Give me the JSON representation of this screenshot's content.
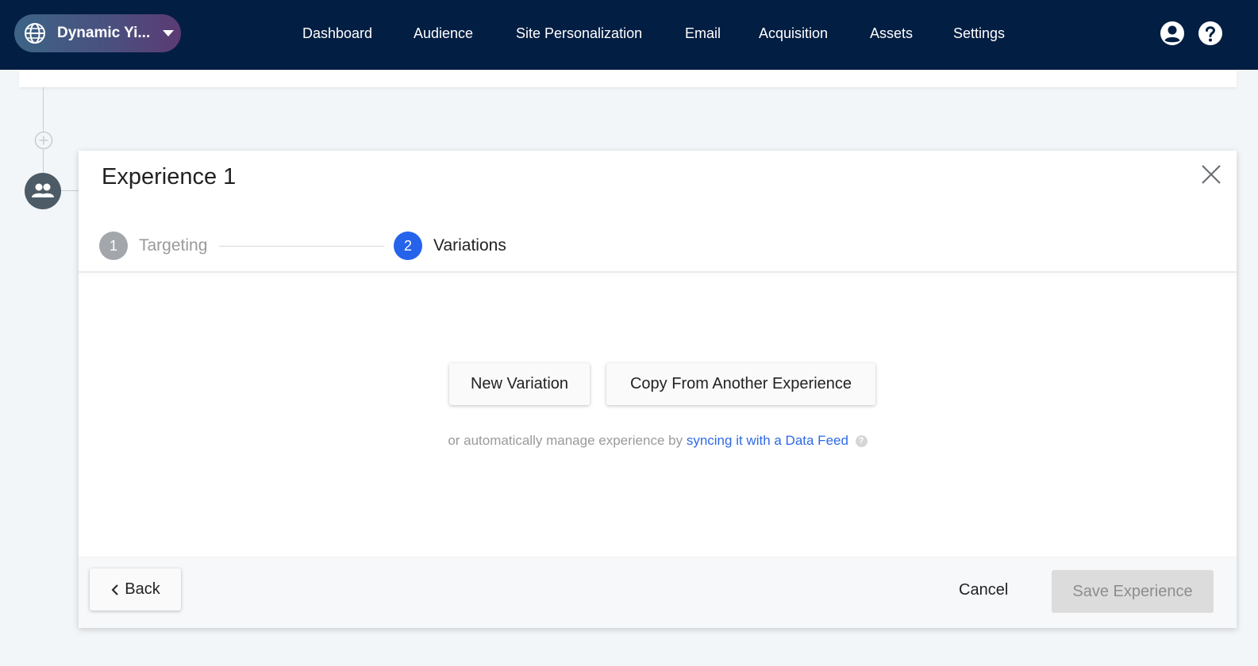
{
  "topbar": {
    "site_selector": {
      "label": "Dynamic Yi...",
      "icon": "globe-icon",
      "caret": "chevron-down-icon"
    },
    "nav_items": [
      {
        "label": "Dashboard"
      },
      {
        "label": "Audience"
      },
      {
        "label": "Site Personalization"
      },
      {
        "label": "Email"
      },
      {
        "label": "Acquisition"
      },
      {
        "label": "Assets"
      },
      {
        "label": "Settings"
      }
    ],
    "icons": [
      "user-account-icon",
      "help-icon"
    ]
  },
  "flow": {
    "add_icon": "plus-circle-icon",
    "audience_icon": "users-icon"
  },
  "modal": {
    "title": "Experience 1",
    "close_icon": "close-icon",
    "steps": [
      {
        "number": "1",
        "label": "Targeting",
        "state": "done"
      },
      {
        "number": "2",
        "label": "Variations",
        "state": "active"
      }
    ],
    "actions": {
      "new_variation": "New Variation",
      "copy_from": "Copy From Another Experience"
    },
    "helper": {
      "prefix": "or automatically manage experience by",
      "link": "syncing it with a Data Feed",
      "help_icon": "question-icon",
      "help_glyph": "?"
    },
    "footer": {
      "back": "Back",
      "cancel": "Cancel",
      "save": "Save Experience"
    }
  },
  "colors": {
    "topbar_bg": "#031e43",
    "active_step": "#2563eb",
    "done_step": "#a3a7ab",
    "link": "#2f69e6",
    "save_disabled_bg": "#dcdcdc"
  }
}
